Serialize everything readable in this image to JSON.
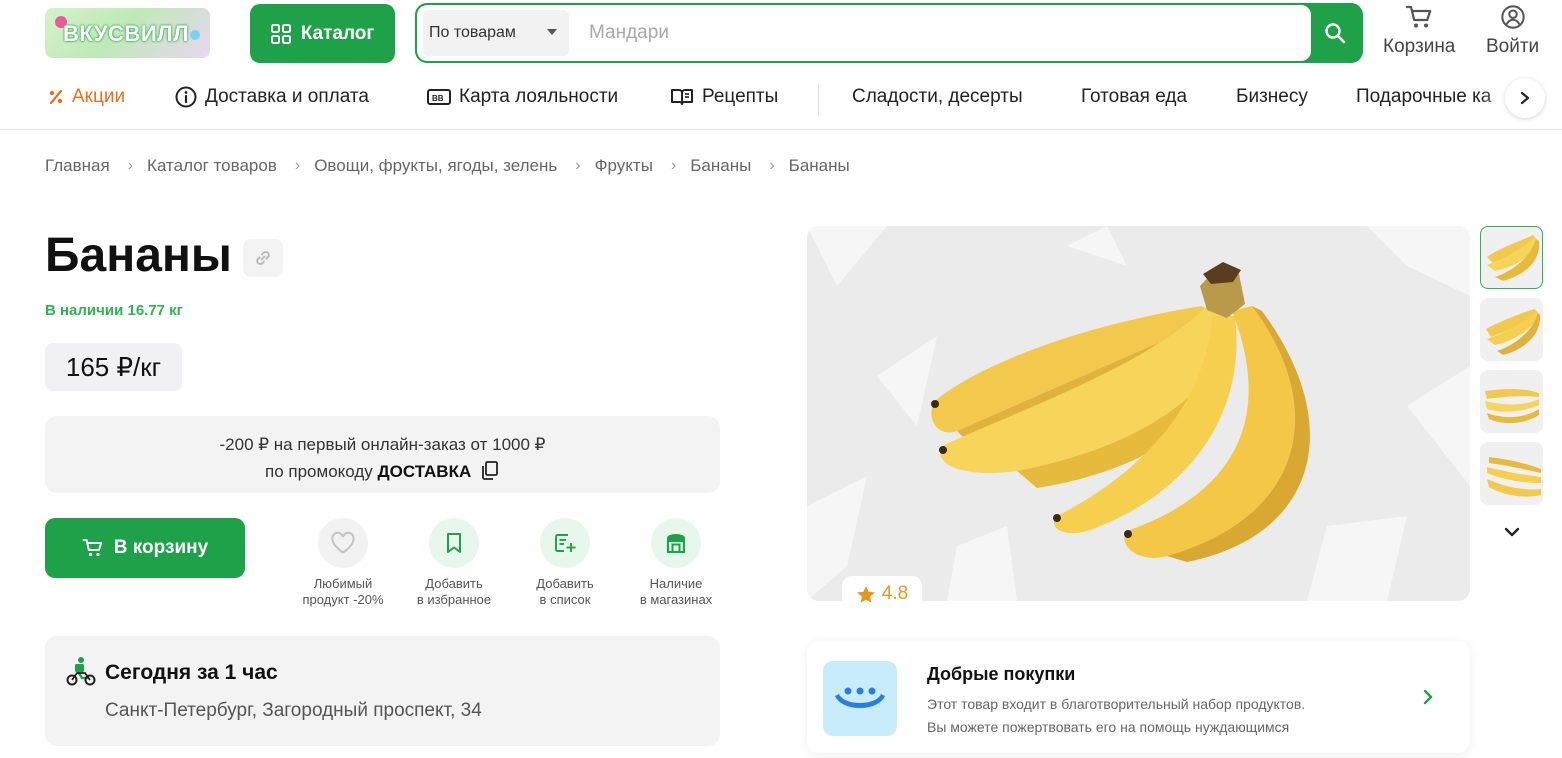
{
  "header": {
    "logo_text": "ВКУСВИЛЛ",
    "catalog_label": "Каталог",
    "search": {
      "scope": "По товарам",
      "placeholder": "Мандари"
    },
    "cart_label": "Корзина",
    "login_label": "Войти"
  },
  "nav": {
    "items": [
      {
        "label": "Акции",
        "icon": "percent-icon"
      },
      {
        "label": "Доставка и оплата",
        "icon": "info-icon"
      },
      {
        "label": "Карта лояльности",
        "icon": "card-icon"
      },
      {
        "label": "Рецепты",
        "icon": "book-icon"
      },
      {
        "label": "Сладости, десерты"
      },
      {
        "label": "Готовая еда"
      },
      {
        "label": "Бизнесу"
      },
      {
        "label": "Подарочные ка"
      }
    ]
  },
  "breadcrumbs": [
    "Главная",
    "Каталог товаров",
    "Овощи, фрукты, ягоды, зелень",
    "Фрукты",
    "Бананы",
    "Бананы"
  ],
  "product": {
    "title": "Бананы",
    "stock": "В наличии 16.77 кг",
    "price": "165 ₽/кг",
    "promo_line1": "-200 ₽ на первый онлайн-заказ от 1000 ₽",
    "promo_line2_prefix": "по промокоду",
    "promo_code": "ДОСТАВКА",
    "add_to_cart": "В корзину",
    "actions": {
      "favorite_line1": "Любимый",
      "favorite_line2": "продукт -20%",
      "bookmark_line1": "Добавить",
      "bookmark_line2": "в избранное",
      "list_line1": "Добавить",
      "list_line2": "в список",
      "stores_line1": "Наличие",
      "stores_line2": "в магазинах"
    },
    "rating": "4.8"
  },
  "delivery": {
    "title": "Сегодня за 1 час",
    "address": "Санкт-Петербург, Загородный проспект, 34"
  },
  "charity": {
    "title": "Добрые покупки",
    "line1": "Этот товар входит в благотворительный набор продуктов.",
    "line2": "Вы можете пожертвовать его на помощь нуждающимся"
  },
  "colors": {
    "brand_green": "#1fa14a",
    "stock_green": "#2fb351",
    "promo_orange": "#e8701d",
    "rating_orange": "#e8961d"
  }
}
